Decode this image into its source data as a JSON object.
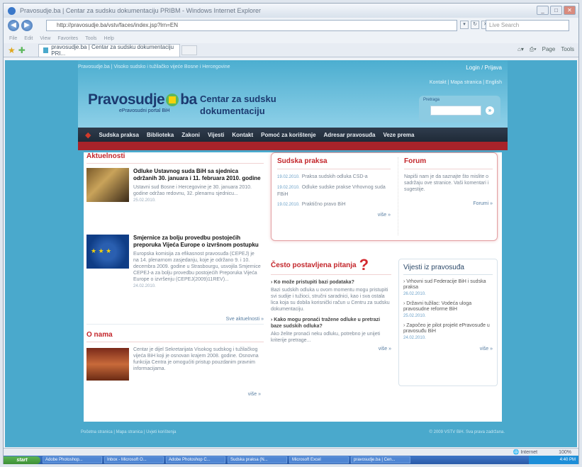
{
  "browser": {
    "title": "Pravosudje.ba | Centar za sudsku dokumentaciju PRIBM - Windows Internet Explorer",
    "address": "http://pravosudje.ba/vstv/faces/index.jsp?lrn=EN",
    "search_placeholder": "Live Search",
    "menu": [
      "File",
      "Edit",
      "View",
      "Favorites",
      "Tools",
      "Help"
    ],
    "tab_label": "pravosudje.ba | Centar za sudsku dokumentaciju PRI...",
    "cmd": [
      "Page",
      "Tools"
    ],
    "status_zone": "Internet",
    "zoom": "100%"
  },
  "site": {
    "top_links": "Pravosudje.ba | Visoko sudsko i tužilačko vijeće Bosne i Hercegovine",
    "login": "Login / Prijava",
    "links2": "Kontakt | Mapa stranica | English",
    "logo_text_a": "Pravosudje",
    "logo_text_b": "ba",
    "logo_sub": "ePravosudni portal BiH",
    "title": "Centar za sudsku dokumentaciju",
    "search_label": "Pretraga",
    "nav": [
      "Sudska praksa",
      "Biblioteka",
      "Zakoni",
      "Vijesti",
      "Kontakt",
      "Pomoć za korištenje",
      "Adresar pravosuđa",
      "Veze prema"
    ],
    "aktuelnosti": {
      "title": "Aktuelnosti",
      "items": [
        {
          "head": "Odluke Ustavnog suda BiH sa sjednica održanih 30. januara i 11. februara 2010. godine",
          "body": "Ustavni sud Bosne i Hercegovine je 30. januara 2010. godine održao redovnu, 32. plenarnu sjednicu...",
          "date": "25.02.2010."
        },
        {
          "head": "Smjernice za bolju provedbu postojećih preporuka Vijeća Europe o izvršnom postupku",
          "body": "Europska komisija za efikasnost pravosuđa (CEPEJ) je na 14. plenarnom zasjedanju, koje je održano 9. i 10. decembra 2009. godine u Strasbourgu, usvojila Smjernice CEPEJ-a za bolju provedbu postojećih Preporuka Vijeća Europe o izvršenju (CEPEJ(2009)11REV)...",
          "date": "24.02.2010."
        }
      ],
      "more": "Sve aktuelnosti"
    },
    "onama": {
      "title": "O nama",
      "body": "Centar je dijel Sekretarijata Visokog sudskog i tužilačkog vijeća BiH koji je osnovan krajem 2008. godine. Osnovna funkcija Centra je omogućiti pristup pouzdanim pravnim informacijama.",
      "more": "više"
    },
    "sudska_praksa": {
      "title": "Sudska praksa",
      "items": [
        {
          "date": "19.02.2010.",
          "text": "Praksa sudskih odluka CSD-a"
        },
        {
          "date": "19.02.2010.",
          "text": "Odluke sudske prakse Vrhovnog suda FBiH"
        },
        {
          "date": "19.02.2010.",
          "text": "Praktično pravo BiH"
        }
      ],
      "more": "više"
    },
    "forum": {
      "title": "Forum",
      "body": "Napiši nam je da saznajte što mislite o sadržaju ove stranice. Vaši komentari i sugestije.",
      "more": "Forumi"
    },
    "faq": {
      "title": "Često postavljena pitanja",
      "q1": "Ko može pristupiti bazi podataka?",
      "a1": "Bazi sudskih odluka u ovom momentu mogu pristupiti svi sudije i tužioci, stručni saradnici, kao i sva ostala lica koja su dobila korisnički račun u Centru za sudsku dokumentaciju.",
      "q2": "Kako mogu pronaći tražene odluke u pretrazi baze sudskih odluka?",
      "a2": "Ako želite pronaći neku odluku, potrebno je unijeti kriterije pretrage...",
      "more": "više"
    },
    "vijesti": {
      "title": "Vijesti iz pravosuđa",
      "items": [
        {
          "text": "Vrhovni sud Federacije BiH i sudska praksa",
          "date": "26.02.2010."
        },
        {
          "text": "Državni tužilac: Vodeća uloga pravosudne reforme BiH",
          "date": "25.02.2010."
        },
        {
          "text": "Započeo je pilot projekt ePravosuđe u pravosuđu BiH",
          "date": "24.02.2010."
        }
      ],
      "more": "više"
    },
    "footer_left": "Početna stranica | Mapa stranica | Uvjeti korištenja",
    "footer_right": "© 2009 VSTV BiH. Sva prava zadržana."
  },
  "taskbar": {
    "start": "start",
    "items": [
      "Adobe Photoshop...",
      "Inbox - Microsoft O...",
      "Adobe Photoshop C...",
      "Sudska praksa (N...",
      "Microsoft Excel",
      "pravosudje.ba | Cen..."
    ],
    "tray": "4:40 PM"
  }
}
